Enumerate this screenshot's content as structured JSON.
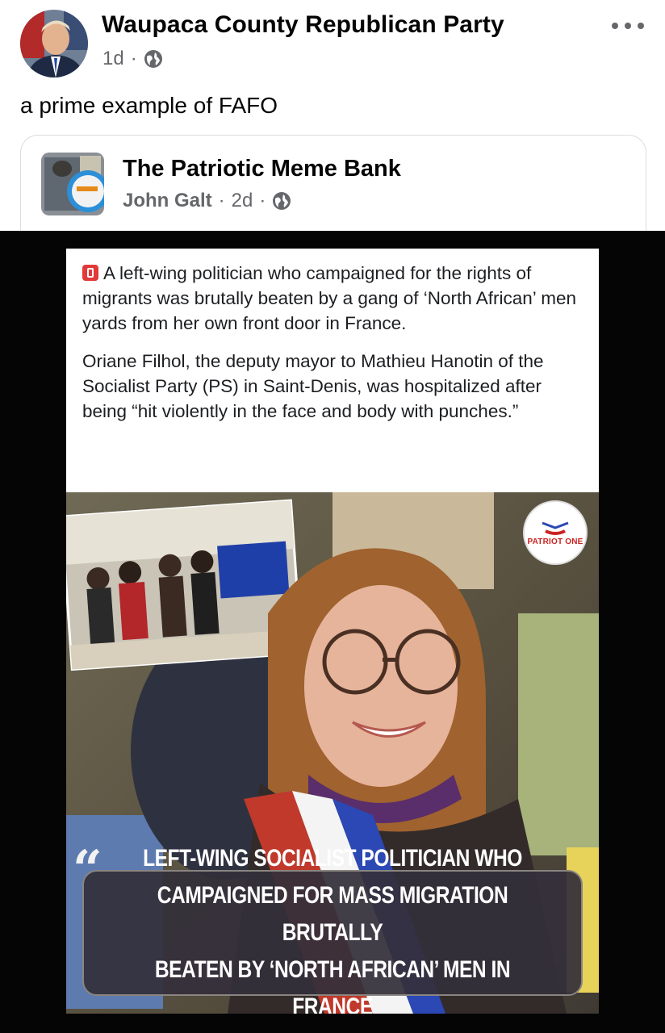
{
  "post": {
    "page_name": "Waupaca County Republican Party",
    "time": "1d",
    "separator": "·",
    "privacy_icon": "globe-icon",
    "more_icon": "more-options-icon",
    "caption": "a prime example of FAFO"
  },
  "shared": {
    "page_name": "The Patriotic Meme Bank",
    "author": "John Galt",
    "time": "2d",
    "separator": "·",
    "privacy_icon": "globe-icon"
  },
  "meme": {
    "paragraph1": "A left-wing politician who campaigned for the rights of migrants was brutally beaten by a gang of ‘North African’ men yards from her own front door in France.",
    "paragraph2": "Oriane Filhol, the deputy mayor to Mathieu Hanotin of the Socialist Party (PS) in Saint-Denis, was hospitalized after being “hit violently in the face and body with punches.”",
    "logo_text": "PATRIOT ONE",
    "quote_mark": "“",
    "headline": "LEFT-WING SOCIALIST POLITICIAN WHO\nCAMPAIGNED FOR MASS MIGRATION BRUTALLY\nBEATEN BY ‘NORTH AFRICAN’ MEN IN FRANCE"
  },
  "colors": {
    "link_gray": "#65676b",
    "headline_box": "#342f3a",
    "badge_red": "#e03a3a"
  }
}
